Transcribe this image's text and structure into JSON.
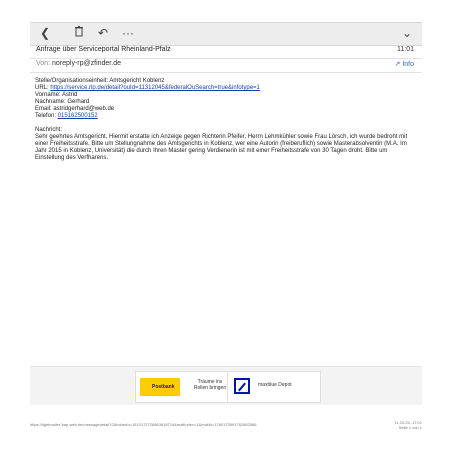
{
  "toolbar": {
    "back_icon": "chevron-left-icon",
    "delete_icon": "trash-icon",
    "reply_icon": "reply-icon",
    "more_label": "···",
    "expand_icon": "chevron-down-icon"
  },
  "email": {
    "subject": "Anfrage über Serviceportal Rheinland-Pfalz",
    "time": "11:01",
    "from_label": "Von:",
    "from_address": "noreply-rp@zfinder.de",
    "info_label": "Info",
    "body": {
      "org_line": "Stelle/Organisationseinheit: Amtsgericht Koblenz",
      "url_label": "URL:",
      "url_value": "https://service.rlp.de/detail?ouId=11312045&federalOuSearch=true&infotype=1",
      "vorname": "Vorname: Astrid",
      "nachname": "Nachname: Gerhard",
      "email_label": "Email:",
      "email_value": "astridgerhard@web.de",
      "telefon_label": "Telefon:",
      "telefon_value": "015162500152",
      "nachricht_label": "Nachricht:",
      "message": "Sehr geehrtes Amtsgericht, Hiermit erstatte ich Anzeige gegen Richterin Pfeifer, Herrn Lehmkühler sowie Frau Lörsch, ich wurde bedroht mit einer Freiheitsstrafe. Bitte um Stellungnahme des Amtsgerichts in Koblenz, wer eine Autorin (freiberuflich) sowie Masterabsolventin (M.A. Im Jahr 2015 in Koblenz, Universität) die durch Ihren Master gering Verdienerin ist mit einer Freiheitsstrafe von 30 Tagen droht. Bitte um Einstellung des Verfharens."
    }
  },
  "ads": {
    "postbank_logo": "Postbank",
    "postbank_claim": "Träume ins Rollen bringen",
    "deutsche_text": "maxblue Depot"
  },
  "print": {
    "url": "https://lightmailer-bap.web.de/messagedetail?2&folderId=1510172726863618716&mailIndex=1&mailId=1760173591762682066",
    "date": "11.10.25, 17:01",
    "page": "Seite 1 von 1"
  }
}
